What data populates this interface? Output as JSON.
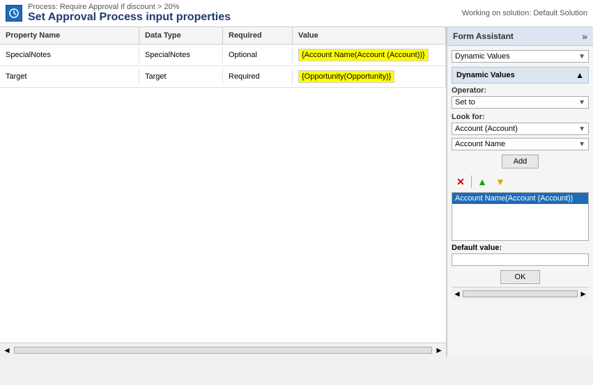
{
  "topBar": {
    "processLabel": "Process: Require Approval if discount > 20%",
    "mainTitle": "Set Approval Process input properties",
    "workingOn": "Working on solution: Default Solution",
    "iconLabel": "gear"
  },
  "table": {
    "headers": [
      "Property Name",
      "Data Type",
      "Required",
      "Value"
    ],
    "rows": [
      {
        "propertyName": "SpecialNotes",
        "dataType": "SpecialNotes",
        "required": "Optional",
        "value": "{Account Name(Account (Account))}"
      },
      {
        "propertyName": "Target",
        "dataType": "Target",
        "required": "Required",
        "value": "{Opportunity(Opportunity)}"
      }
    ]
  },
  "formAssistant": {
    "title": "Form Assistant",
    "chevronLabel": "»",
    "dynamicValuesLabel": "Dynamic Values",
    "sectionTitle": "Dynamic Values",
    "operatorLabel": "Operator:",
    "operatorValue": "Set to",
    "lookForLabel": "Look for:",
    "lookForValue": "Account (Account)",
    "fieldValue": "Account Name",
    "addLabel": "Add",
    "listItems": [
      "Account Name(Account (Account))"
    ],
    "selectedItem": "Account Name(Account (Account))",
    "defaultValueLabel": "Default value:",
    "okLabel": "OK"
  },
  "bottomBar": {
    "leftArrow": "◄",
    "rightArrow": "►"
  },
  "rightScroll": {
    "leftArrow": "◄",
    "rightArrow": "►"
  }
}
